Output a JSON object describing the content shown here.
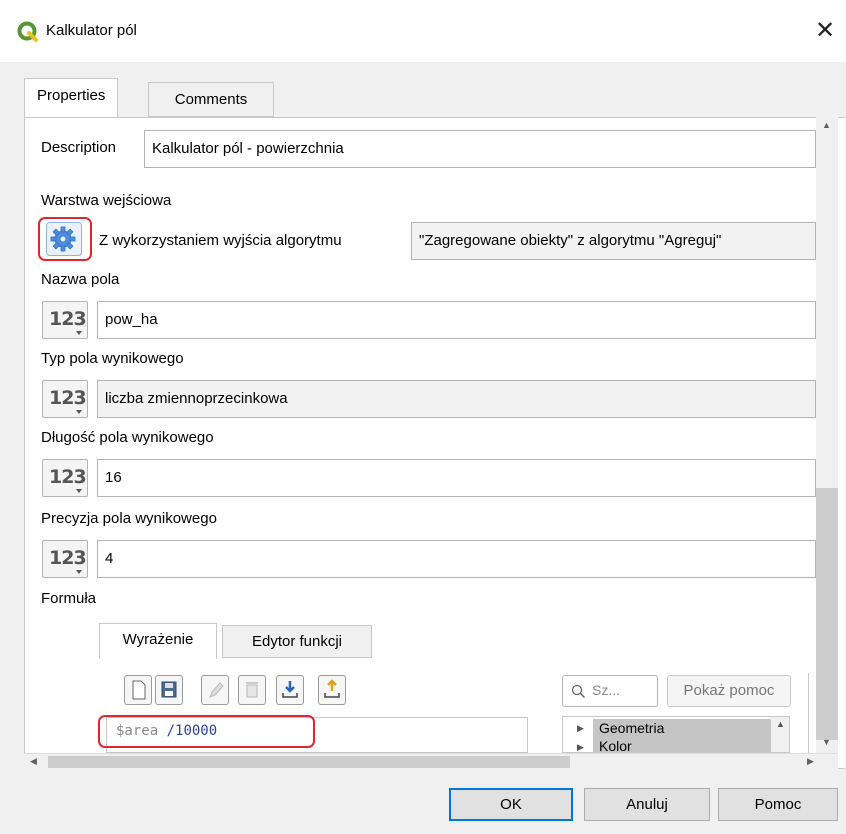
{
  "window": {
    "title": "Kalkulator pól",
    "close_glyph": "✕"
  },
  "tabs": [
    {
      "label": "Properties"
    },
    {
      "label": "Comments"
    }
  ],
  "description": {
    "label": "Description",
    "value": "Kalkulator pól - powierzchnia"
  },
  "input_layer": {
    "label": "Warstwa wejściowa",
    "source_text": "Z wykorzystaniem wyjścia algorytmu",
    "value": "\"Zagregowane obiekty\" z algorytmu \"Agreguj\"",
    "icon": "gear-icon"
  },
  "field_name": {
    "label": "Nazwa pola",
    "value": "pow_ha"
  },
  "field_type": {
    "label": "Typ pola wynikowego",
    "value": "liczba zmiennoprzecinkowa"
  },
  "field_length": {
    "label": "Długość pola wynikowego",
    "value": "16"
  },
  "field_precision": {
    "label": "Precyzja pola wynikowego",
    "value": "4"
  },
  "number_button": {
    "glyph": "123"
  },
  "formula": {
    "label": "Formuła",
    "tabs": [
      {
        "label": "Wyrażenie"
      },
      {
        "label": "Edytor funkcji"
      }
    ],
    "expression_var": "$area",
    "expression_op": " /10000",
    "search_placeholder": "Sz...",
    "help_button": "Pokaż pomoc",
    "tree_items": [
      "Geometria",
      "Kolor"
    ]
  },
  "buttons": {
    "ok": "OK",
    "cancel": "Anuluj",
    "help": "Pomoc"
  },
  "colors": {
    "accent": "#0078d7",
    "highlight": "#e1262d",
    "qgis_green": "#589632"
  }
}
